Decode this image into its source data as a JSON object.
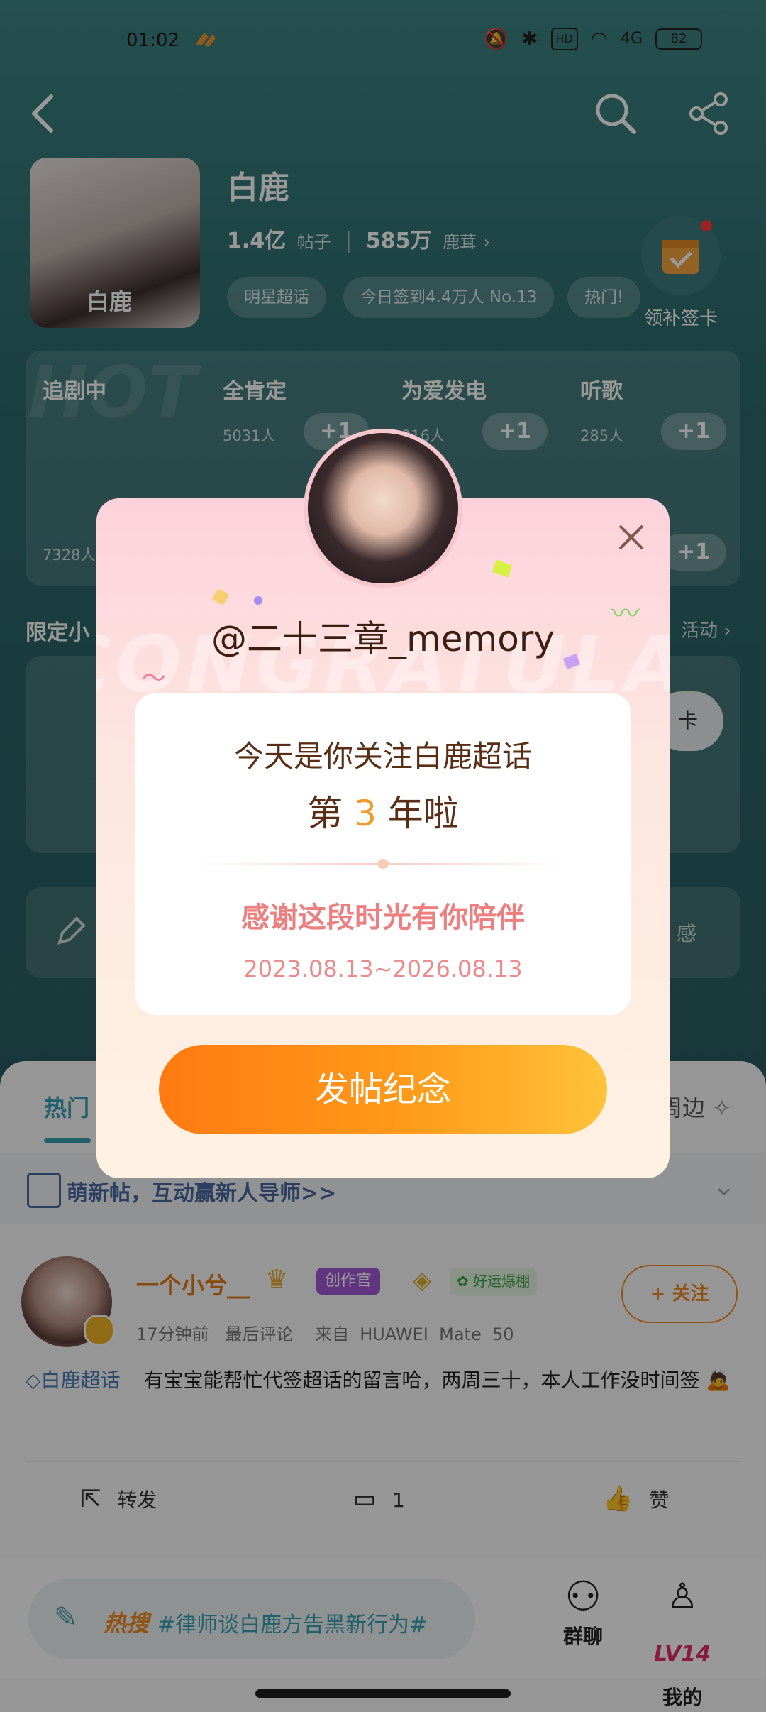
{
  "status_bar": {
    "time": "01:02",
    "battery": "82",
    "network": "4G",
    "hd": "HD"
  },
  "header": {
    "name": "白鹿",
    "posts_count": "1.4亿",
    "posts_label": "帖子",
    "fans_count": "585万",
    "fans_label": "鹿茸",
    "avatar_caption": "白鹿",
    "chips": [
      "明星超话",
      "今日签到4.4万人  No.13",
      "热门!"
    ],
    "checkin_label": "领补签卡"
  },
  "activities": {
    "featured": {
      "title": "追剧中",
      "count": "7328人",
      "plus": "+1"
    },
    "cells": [
      {
        "title": "全肯定",
        "count": "5031人",
        "plus": "+1"
      },
      {
        "title": "为爱发电",
        "count": "916人",
        "plus": "+1"
      },
      {
        "title": "听歌",
        "count": "285人",
        "plus": "+1"
      }
    ]
  },
  "section": {
    "limited_label": "限定小",
    "more_activity": "活动",
    "card_button": "卡",
    "feel_label": "感"
  },
  "tabs": {
    "hot": "热门",
    "around": "周边"
  },
  "notice": {
    "text": "萌新帖，互动赢新人导师>>"
  },
  "post": {
    "author": "一个小兮__",
    "badge_creator": "创作官",
    "badge_lucky": "好运爆棚",
    "meta": "17分钟前   最后评论    来自  HUAWEI  Mate  50",
    "follow": "+ 关注",
    "topic": "白鹿超话",
    "content": "有宝宝能帮忙代签超话的留言哈，两周三十，本人工作没时间签",
    "actions": {
      "repost": "转发",
      "comment_count": "1",
      "like": "赞"
    }
  },
  "bottom_nav": {
    "hot_prefix": "热搜",
    "hot_topic": "#律师谈白鹿方告黑新行为#",
    "group_chat": "群聊",
    "mine": "我的",
    "level": "LV14"
  },
  "modal": {
    "watermark": "CONGRATULATE",
    "username": "@二十三章_memory",
    "line1": "今天是你关注白鹿超话",
    "line2_prefix": "第 ",
    "years": "3",
    "line2_suffix": " 年啦",
    "thanks": "感谢这段时光有你陪伴",
    "dates": "2023.08.13~2026.08.13",
    "cta": "发帖纪念"
  },
  "colors": {
    "teal": "#2e6b6e",
    "orange": "#ff8a18",
    "pink_bg": "#fdd2dc",
    "brown_text": "#5a2e16"
  }
}
